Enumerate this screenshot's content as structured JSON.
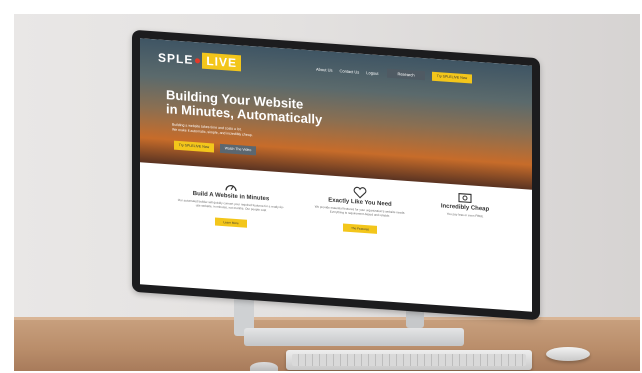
{
  "site": {
    "logo_left": "SPLE",
    "logo_right": "LIVE",
    "nav": [
      "About Us",
      "Contact Us",
      "Logout"
    ],
    "research_label": "Research",
    "try_top_label": "Try SPLELIVE Now",
    "hero_title_1": "Building Your Website",
    "hero_title_2": "in Minutes, Automatically",
    "hero_sub_1": "Building a website takes time and costs a lot.",
    "hero_sub_2": "We make it automatic, simple, and incredibly cheap.",
    "try_label": "Try SPLELIVE Now",
    "video_label": "Watch The Video",
    "features": [
      {
        "icon": "gauge-icon",
        "title": "Build A Website in Minutes",
        "desc": "Our automated builder will quickly convert your required features for a ready-for-use website, in minutes, not months. Our people cost",
        "button": "Learn More"
      },
      {
        "icon": "heart-icon",
        "title": "Exactly Like You Need",
        "desc": "We provide essential features for your organization's website needs. Everything is requirement-based and reliable.",
        "button": "The Features"
      },
      {
        "icon": "money-icon",
        "title": "Incredibly Cheap",
        "desc": "You pay less or even FREE",
        "button": ""
      }
    ]
  }
}
